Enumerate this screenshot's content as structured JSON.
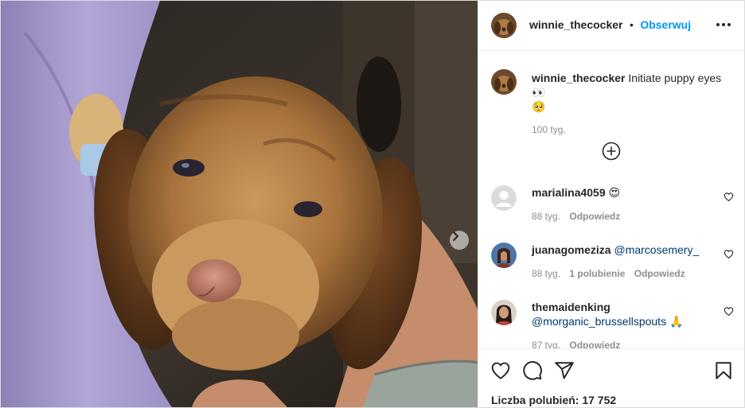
{
  "post": {
    "username": "winnie_thecocker",
    "separator": "•",
    "follow_label": "Obserwuj",
    "caption_username": "winnie_thecocker",
    "caption_text": "Initiate puppy eyes 👀",
    "caption_trailing": "🥺",
    "caption_time": "100 tyg.",
    "likes_text": "Liczba polubień: 17 752"
  },
  "comments": [
    {
      "username": "marialina4059",
      "text": "😍",
      "time": "88 tyg.",
      "likes": "",
      "reply": "Odpowiedz"
    },
    {
      "username": "juanagomeziza",
      "text": "@marcosemery_",
      "time": "88 tyg.",
      "likes": "1 polubienie",
      "reply": "Odpowiedz"
    },
    {
      "username": "themaidenking",
      "text": "@morganic_brussellspouts 🙏",
      "time": "87 tyg.",
      "likes": "",
      "reply": "Odpowiedz"
    }
  ],
  "icons": {
    "more": "more-options-icon",
    "load_more": "plus-circle-icon",
    "like": "heart-icon",
    "comment": "comment-icon",
    "share": "share-icon",
    "save": "bookmark-icon",
    "next": "chevron-right-icon"
  },
  "colors": {
    "follow": "#0095f6",
    "text": "#262626",
    "meta": "#8e8e8e",
    "border": "#efefef"
  }
}
